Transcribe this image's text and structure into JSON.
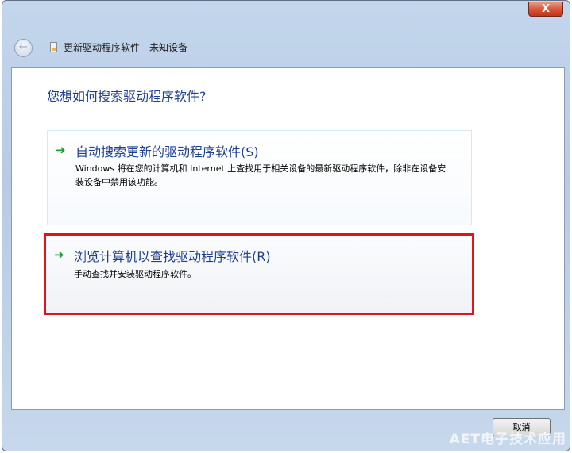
{
  "window": {
    "title": "更新驱动程序软件 - 未知设备",
    "close_label": "X"
  },
  "main": {
    "question": "您想如何搜索驱动程序软件?",
    "options": [
      {
        "title": "自动搜索更新的驱动程序软件(S)",
        "description": "Windows 将在您的计算机和 Internet 上查找用于相关设备的最新驱动程序软件，除非在设备安装设备中禁用该功能。"
      },
      {
        "title": "浏览计算机以查找驱动程序软件(R)",
        "description": "手动查找并安装驱动程序软件。"
      }
    ]
  },
  "footer": {
    "cancel_label": "取消"
  },
  "watermark": "AET电子技术应用",
  "colors": {
    "link_blue": "#1f3f8f",
    "arrow_green": "#1e9a2e",
    "highlight_red": "#e0151c"
  },
  "icons": {
    "back": "back-arrow-icon",
    "option": "green-arrow-icon"
  }
}
